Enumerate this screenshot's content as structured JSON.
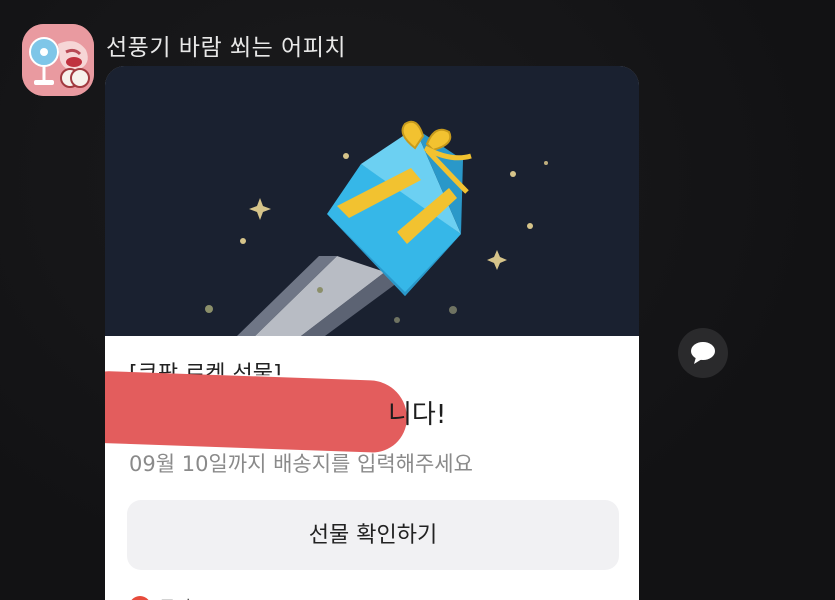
{
  "sender": {
    "name": "선풍기 바람 쐬는 어피치",
    "avatar_icon": "apeach-fan-avatar"
  },
  "card": {
    "hero_icon": "flying-gift-box-icon",
    "colors": {
      "hero_bg": "#1a2130",
      "gift_blue": "#36b7e8",
      "gift_ribbon": "#f2c230"
    },
    "tag": "[쿠팡 로켓 선물]",
    "headline_suffix": "니다!",
    "subtitle": "09월 10일까지 배송지를 입력해주세요",
    "confirm_label": "선물 확인하기",
    "footer_label": "쿠팡"
  },
  "side": {
    "share_icon": "speech-bubble-icon"
  }
}
